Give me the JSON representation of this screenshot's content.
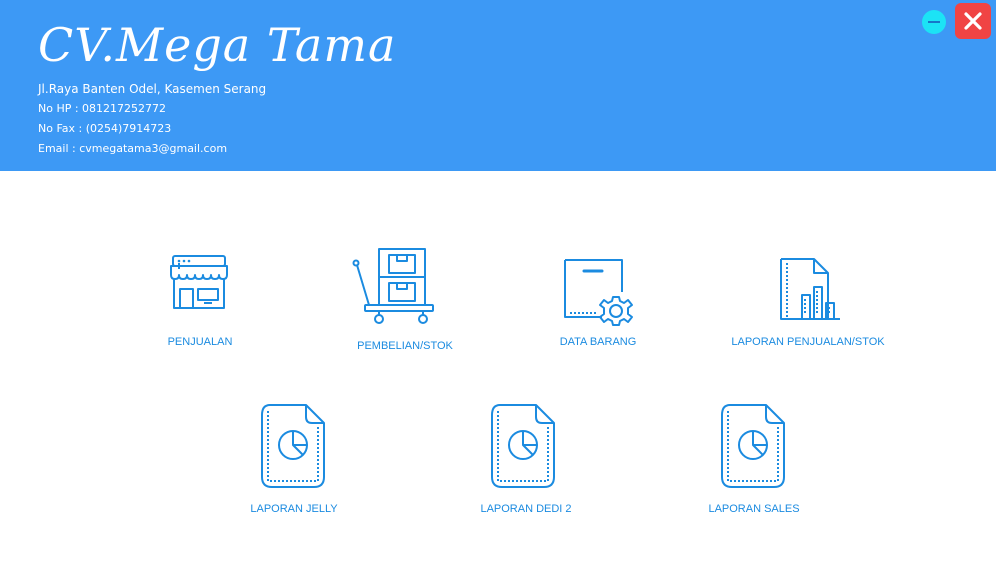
{
  "header": {
    "brand": "CV.Mega Tama",
    "address": "Jl.Raya Banten Odel, Kasemen Serang",
    "phone": "No HP : 081217252772",
    "fax": "No Fax : (0254)7914723",
    "email": "Email : cvmegatama3@gmail.com",
    "background_color": "#3d99f5"
  },
  "window_controls": {
    "minimize_icon": "minus-icon",
    "close_icon": "close-icon",
    "close_color": "#f04444",
    "minimize_color": "#1ce3f5"
  },
  "menu": {
    "accent_color": "#1b8be0",
    "penjualan": {
      "label": "PENJUALAN",
      "icon": "store-icon"
    },
    "pembelian": {
      "label": "PEMBELIAN/STOK",
      "icon": "cart-boxes-icon"
    },
    "data_barang": {
      "label": "DATA BARANG",
      "icon": "box-gear-icon"
    },
    "laporan_penjualan": {
      "label": "LAPORAN PENJUALAN/STOK",
      "icon": "report-chart-icon"
    },
    "laporan_jelly": {
      "label": "LAPORAN JELLY",
      "icon": "pie-document-icon"
    },
    "laporan_dedi": {
      "label": "LAPORAN DEDI 2",
      "icon": "pie-document-icon"
    },
    "laporan_sales": {
      "label": "LAPORAN SALES",
      "icon": "pie-document-icon"
    }
  }
}
